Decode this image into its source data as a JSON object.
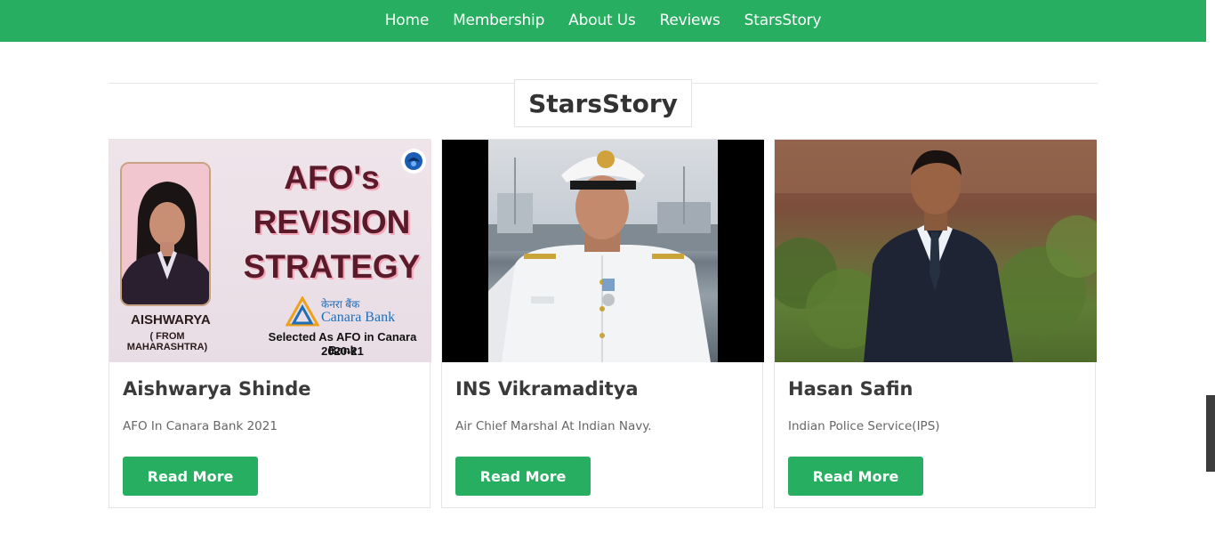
{
  "nav": {
    "items": [
      "Home",
      "Membership",
      "About Us",
      "Reviews",
      "StarsStory"
    ]
  },
  "section": {
    "title": "StarsStory"
  },
  "cards": [
    {
      "title": "Aishwarya Shinde",
      "subtitle": "AFO In Canara Bank 2021",
      "button": "Read More",
      "image": {
        "type": "promo-poster",
        "name": "AISHWARYA",
        "from": "( FROM MAHARASHTRA)",
        "headline": [
          "AFO's",
          "REVISION",
          "STRATEGY"
        ],
        "bank_hindi": "केनरा बैंक",
        "bank": "Canara Bank",
        "selected": "Selected As AFO in Canara Bank",
        "year": "2020-21"
      }
    },
    {
      "title": "INS Vikramaditya",
      "subtitle": "Air Chief Marshal At Indian Navy.",
      "button": "Read More",
      "image": {
        "type": "photo-naval-officer"
      }
    },
    {
      "title": "Hasan Safin",
      "subtitle": "Indian Police Service(IPS)",
      "button": "Read More",
      "image": {
        "type": "photo-man-in-suit"
      }
    }
  ],
  "colors": {
    "accent": "#27ae60",
    "heading": "#333333",
    "text_muted": "#666666"
  }
}
